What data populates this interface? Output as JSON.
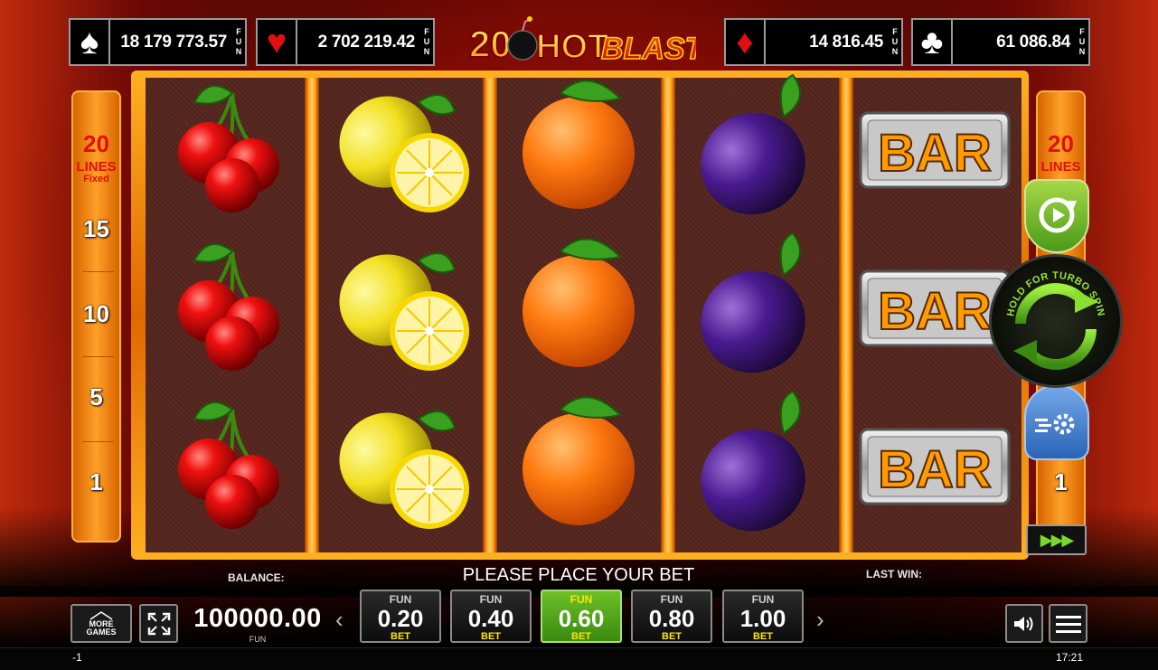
{
  "jackpots": [
    {
      "suit": "spade-icon",
      "glyph": "♠",
      "color": "#111111",
      "value": "18 179 773.57",
      "unit": "FUN"
    },
    {
      "suit": "heart-icon",
      "glyph": "♥",
      "color": "#e01010",
      "value": "2 702 219.42",
      "unit": "FUN"
    },
    {
      "suit": "diamond-icon",
      "glyph": "♦",
      "color": "#e01010",
      "value": "14 816.45",
      "unit": "FUN"
    },
    {
      "suit": "club-icon",
      "glyph": "♣",
      "color": "#111111",
      "value": "61 086.84",
      "unit": "FUN"
    }
  ],
  "logo": {
    "number": "20",
    "word1": "HOT",
    "word2": "BLAST"
  },
  "lines": {
    "count": "20",
    "label": "LINES",
    "mode": "Fixed",
    "markers": [
      "15",
      "10",
      "5",
      "1"
    ]
  },
  "reels": [
    [
      "cherry",
      "cherry",
      "cherry"
    ],
    [
      "lemon",
      "lemon",
      "lemon"
    ],
    [
      "orange",
      "orange",
      "orange"
    ],
    [
      "plum",
      "plum",
      "plum"
    ],
    [
      "bar",
      "bar",
      "bar"
    ]
  ],
  "bar_text": "BAR",
  "spin_button": {
    "hint": "HOLD FOR TURBO SPIN"
  },
  "balance": {
    "label": "BALANCE:",
    "value": "100000.00",
    "unit": "FUN"
  },
  "message": "PLEASE PLACE YOUR BET",
  "last_win": {
    "label": "LAST WIN:"
  },
  "more_games": "MORE GAMES",
  "bets": [
    {
      "top": "FUN",
      "value": "0.20",
      "bottom": "BET",
      "selected": false
    },
    {
      "top": "FUN",
      "value": "0.40",
      "bottom": "BET",
      "selected": false
    },
    {
      "top": "FUN",
      "value": "0.60",
      "bottom": "BET",
      "selected": true
    },
    {
      "top": "FUN",
      "value": "0.80",
      "bottom": "BET",
      "selected": false
    },
    {
      "top": "FUN",
      "value": "1.00",
      "bottom": "BET",
      "selected": false
    }
  ],
  "status": {
    "left": "-1",
    "time": "17:21"
  }
}
